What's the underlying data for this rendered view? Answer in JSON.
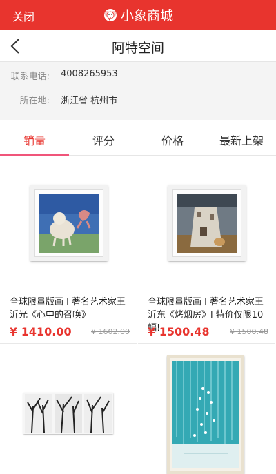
{
  "topbar": {
    "close_label": "关闭",
    "brand_title": "小象商城"
  },
  "navbar": {
    "title": "阿特空间"
  },
  "info": [
    {
      "label": "联系电话:",
      "value": "4008265953"
    },
    {
      "label": "所在地:",
      "value": "浙江省 杭州市"
    }
  ],
  "tabs": [
    {
      "label": "销量",
      "active": true
    },
    {
      "label": "评分",
      "active": false
    },
    {
      "label": "价格",
      "active": false
    },
    {
      "label": "最新上架",
      "active": false
    }
  ],
  "products": [
    {
      "name": "全球限量版画 l 著名艺术家王沂光《心中的召唤》",
      "price": "¥ 1410.00",
      "original_price": "¥ 1602.00"
    },
    {
      "name": "全球限量版画 l 著名艺术家王沂东《烤烟房》l 特价仅限10幅!",
      "price": "¥ 1500.48",
      "original_price": "¥ 1500.48"
    },
    {
      "name": "",
      "price": "",
      "original_price": ""
    },
    {
      "name": "",
      "price": "",
      "original_price": ""
    }
  ],
  "colors": {
    "accent": "#e8342e",
    "tab_indicator": "#f0557a"
  },
  "icons": {
    "back": "chevron-left-icon",
    "logo": "elephant-logo-icon"
  }
}
